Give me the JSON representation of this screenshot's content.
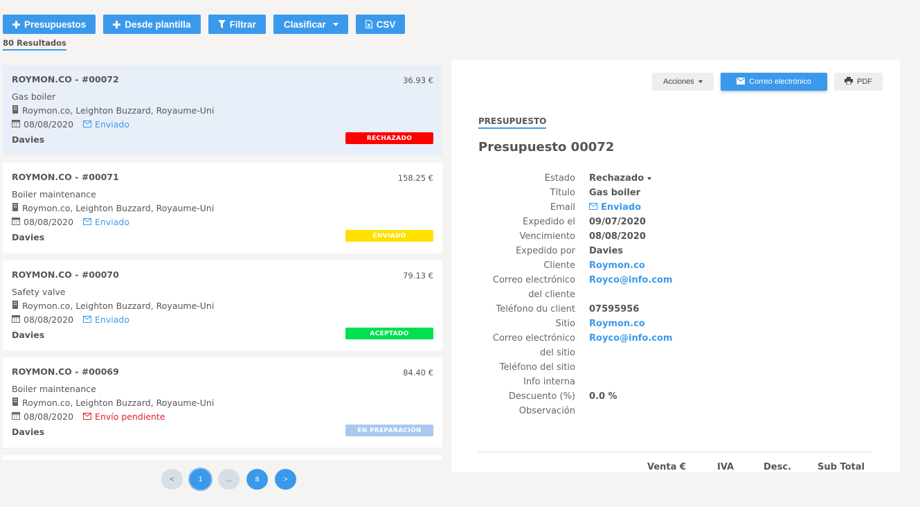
{
  "toolbar": {
    "new_label": "Presupuestos",
    "template_label": "Desde plantilla",
    "filter_label": "Filtrar",
    "sort_label": "Clasificar",
    "csv_label": "CSV"
  },
  "results_label": "80 Resultados",
  "colors": {
    "accent": "#3b99ec",
    "rejected": "#ff0000",
    "sent": "#ffe000",
    "accepted": "#00e050",
    "preparing": "#a8c8ee"
  },
  "quotes": [
    {
      "title": "ROYMON.CO - #00072",
      "amount": "36.93 €",
      "description": "Gas boiler",
      "address": "Roymon.co, Leighton Buzzard, Royaume-Uni",
      "date": "08/08/2020",
      "send_status": "Enviado",
      "author": "Davies",
      "badge": "RECHAZADO"
    },
    {
      "title": "ROYMON.CO - #00071",
      "amount": "158.25 €",
      "description": "Boiler maintenance",
      "address": "Roymon.co, Leighton Buzzard, Royaume-Uni",
      "date": "08/08/2020",
      "send_status": "Enviado",
      "author": "Davies",
      "badge": "ENVIADO"
    },
    {
      "title": "ROYMON.CO - #00070",
      "amount": "79.13 €",
      "description": "Safety valve",
      "address": "Roymon.co, Leighton Buzzard, Royaume-Uni",
      "date": "08/08/2020",
      "send_status": "Enviado",
      "author": "Davies",
      "badge": "ACEPTADO"
    },
    {
      "title": "ROYMON.CO - #00069",
      "amount": "84.40 €",
      "description": "Boiler maintenance",
      "address": "Roymon.co, Leighton Buzzard, Royaume-Uni",
      "date": "08/08/2020",
      "send_status": "Envío pendiente",
      "author": "Davies",
      "badge": "EN PREPARACIÓN"
    }
  ],
  "pagination": {
    "prev": "<",
    "current": "1",
    "ellipsis": "...",
    "last": "8",
    "next": ">"
  },
  "detail": {
    "actions_label": "Acciones",
    "email_label": "Correo electrónico",
    "pdf_label": "PDF",
    "section_label": "PRESUPUESTO",
    "title": "Presupuesto 00072",
    "fields": [
      {
        "label": "Estado",
        "value": "Rechazado"
      },
      {
        "label": "Título",
        "value": "Gas boiler"
      },
      {
        "label": "Email",
        "value": "Enviado"
      },
      {
        "label": "Expedido el",
        "value": "09/07/2020"
      },
      {
        "label": "Vencimiento",
        "value": "08/08/2020"
      },
      {
        "label": "Expedido por",
        "value": "Davies"
      },
      {
        "label": "Cliente",
        "value": "Roymon.co"
      },
      {
        "label": "Correo electrónico",
        "value": "Royco@info.com"
      },
      {
        "label": "del cliente",
        "value": ""
      },
      {
        "label": "Teléfono du client",
        "value": "07595956"
      },
      {
        "label": "Sitio",
        "value": "Roymon.co"
      },
      {
        "label": "Correo electrónico",
        "value": "Royco@info.com"
      },
      {
        "label": "del sitio",
        "value": ""
      },
      {
        "label": "Teléfono del sitio",
        "value": ""
      },
      {
        "label": "Info interna",
        "value": ""
      },
      {
        "label": "Descuento (%)",
        "value": "0.0 %"
      },
      {
        "label": "Observación",
        "value": ""
      }
    ],
    "table_headers": [
      "Venta €",
      "IVA",
      "Desc.",
      "Sub Total"
    ]
  }
}
